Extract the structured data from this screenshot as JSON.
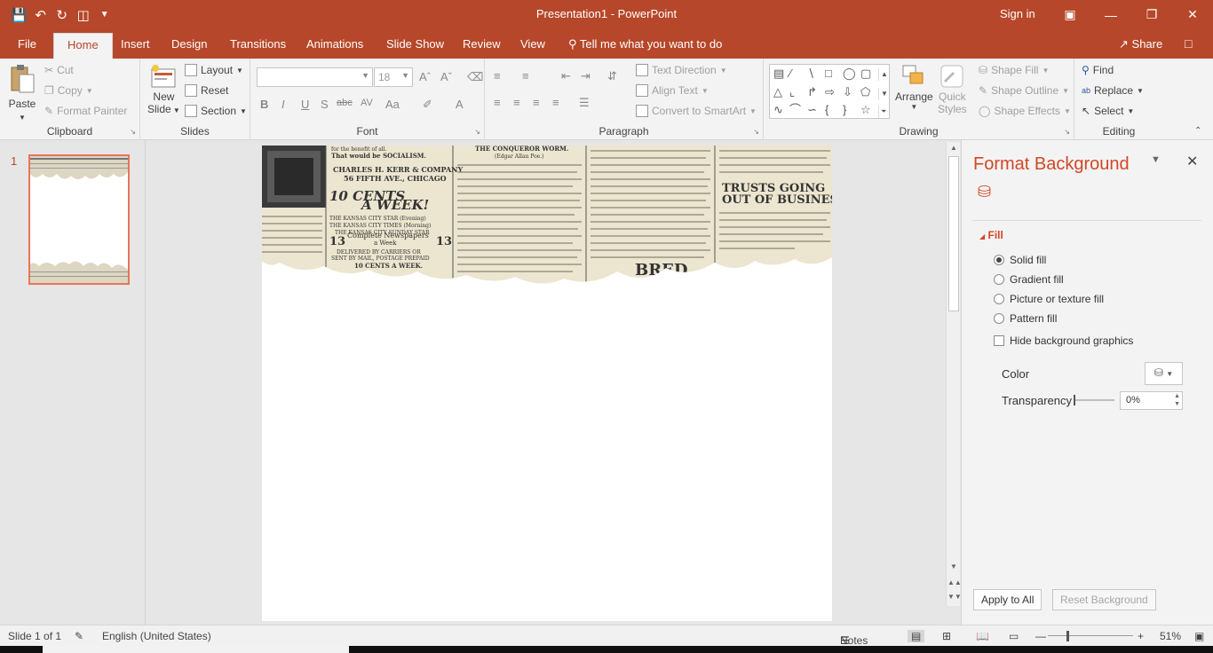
{
  "titlebar": {
    "title": "Presentation1  -  PowerPoint",
    "signin": "Sign in",
    "qat": [
      "save-icon",
      "undo-icon",
      "redo-icon",
      "present-icon",
      "customize-icon"
    ]
  },
  "tabs": [
    "File",
    "Home",
    "Insert",
    "Design",
    "Transitions",
    "Animations",
    "Slide Show",
    "Review",
    "View"
  ],
  "active_tab": "Home",
  "tellme": "Tell me what you want to do",
  "share": "Share",
  "ribbon": {
    "clipboard": {
      "label": "Clipboard",
      "paste": "Paste",
      "cut": "Cut",
      "copy": "Copy",
      "format_painter": "Format Painter"
    },
    "slides": {
      "label": "Slides",
      "new_slide_1": "New",
      "new_slide_2": "Slide",
      "layout": "Layout",
      "reset": "Reset",
      "section": "Section"
    },
    "font": {
      "label": "Font",
      "font_name": "",
      "font_size": "18"
    },
    "paragraph": {
      "label": "Paragraph",
      "text_direction": "Text Direction",
      "align_text": "Align Text",
      "convert_smartart": "Convert to SmartArt"
    },
    "drawing": {
      "label": "Drawing",
      "arrange": "Arrange",
      "quick_styles_1": "Quick",
      "quick_styles_2": "Styles",
      "shape_fill": "Shape Fill",
      "shape_outline": "Shape Outline",
      "shape_effects": "Shape Effects"
    },
    "editing": {
      "label": "Editing",
      "find": "Find",
      "replace": "Replace",
      "select": "Select"
    }
  },
  "slides_pane": {
    "slide_number": "1"
  },
  "slide_content": {
    "col1_1": "for the benefit of all.",
    "col1_2": "That would be SOCIALISM.",
    "col1_3": "CHARLES H. KERR & COMPANY",
    "col1_4": "56 FIFTH AVE., CHICAGO",
    "headline1": "10 CENTS",
    "headline2": "A WEEK!",
    "kc1": "THE KANSAS CITY STAR (Evening)",
    "kc2": "THE KANSAS CITY TIMES (Morning)",
    "kc3": "THE KANSAS CITY SUNDAY STAR",
    "complete": "Complete Newspapers",
    "aweek": "a Week",
    "delivered": "DELIVERED BY CARRIERS OR",
    "sentby": "SENT BY MAIL, POSTAGE PREPAID",
    "tencents": "10 CENTS A WEEK.",
    "conqueror": "THE CONQUEROR WORM.",
    "poe": "(Edgar Allan Poe.)",
    "trusts1": "TRUSTS GOING",
    "trusts2": "OUT OF BUSINESS",
    "num13a": "13",
    "num13b": "13",
    "bred": "BRED"
  },
  "format_pane": {
    "title": "Format Background",
    "fill_header": "Fill",
    "solid_fill": "Solid fill",
    "gradient_fill": "Gradient fill",
    "picture_fill": "Picture or texture fill",
    "pattern_fill": "Pattern fill",
    "hide_graphics": "Hide background graphics",
    "color_label": "Color",
    "transparency_label": "Transparency",
    "transparency_value": "0%",
    "transparency_level": 0,
    "apply_all": "Apply to All",
    "reset_bg": "Reset Background"
  },
  "statusbar": {
    "slide_info": "Slide 1 of 1",
    "language": "English (United States)",
    "notes": "Notes",
    "zoom": "51%"
  },
  "colors": {
    "accent": "#b7472a",
    "pane_title": "#d24726",
    "thumb_border": "#e97458"
  }
}
